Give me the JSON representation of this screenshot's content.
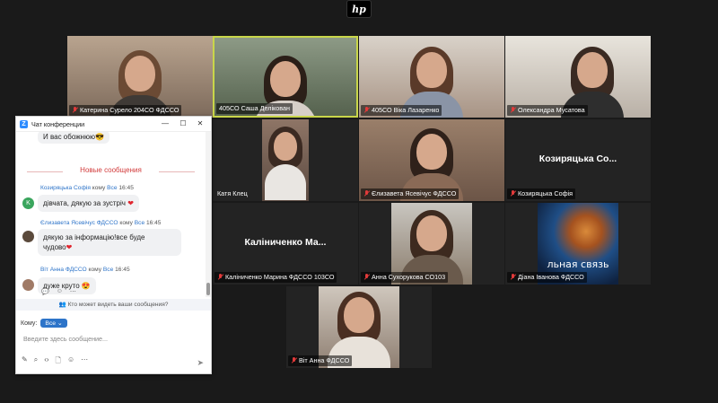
{
  "logo": {
    "text": "hp"
  },
  "tiles": [
    {
      "name": "Катерина Сурело 204СО ФДССО",
      "muted": true
    },
    {
      "name": "405СО Саша Делікован",
      "muted": false
    },
    {
      "name": "405СО Віка Лазаренко",
      "muted": true
    },
    {
      "name": "Олександра Мусатова",
      "muted": true
    },
    {
      "name": "Катя Клец",
      "muted": false
    },
    {
      "name": "Єлизавета Ясевічус ФДССО",
      "muted": true
    },
    {
      "name": "Козиряцька Софія",
      "muted": true,
      "display_name": "Козиряцька  Со..."
    },
    {
      "name": "Каліниченко Марина ФДССО 103СО",
      "muted": true,
      "display_name": "Каліниченко  Ма..."
    },
    {
      "name": "Анна Сухорукова СО103",
      "muted": true
    },
    {
      "name": "Діана Іванова ФДССО",
      "muted": true,
      "overlay_text": "льная связь"
    },
    {
      "name": "Віт Анна ФДССО",
      "muted": true
    }
  ],
  "chat": {
    "title": "Чат конференции",
    "prev_message": "И вас обожнюю😎",
    "new_messages_label": "Новые сообщения",
    "messages": [
      {
        "sender": "Козиряцька Софія",
        "to_word": "кому",
        "to": "Все",
        "time": "16:45",
        "avatar_letter": "K",
        "lines": [
          "дівчата, дякую за зустріч"
        ],
        "heart": true
      },
      {
        "sender": "Єлизавета Ясевічус ФДССО",
        "to_word": "кому",
        "to": "Все",
        "time": "16:45",
        "lines": [
          "дякую за інформацію!все буде",
          "чудово"
        ],
        "heart": true
      },
      {
        "sender": "Віт Анна ФДССО",
        "to_word": "кому",
        "to": "Все",
        "time": "16:45",
        "lines": [
          "дуже круто 😍"
        ],
        "heart": false
      }
    ],
    "privacy": "Кто может видеть ваши сообщения?",
    "to_label": "Кому:",
    "to_value": "Все",
    "input_placeholder": "Введите здесь сообщение..."
  }
}
